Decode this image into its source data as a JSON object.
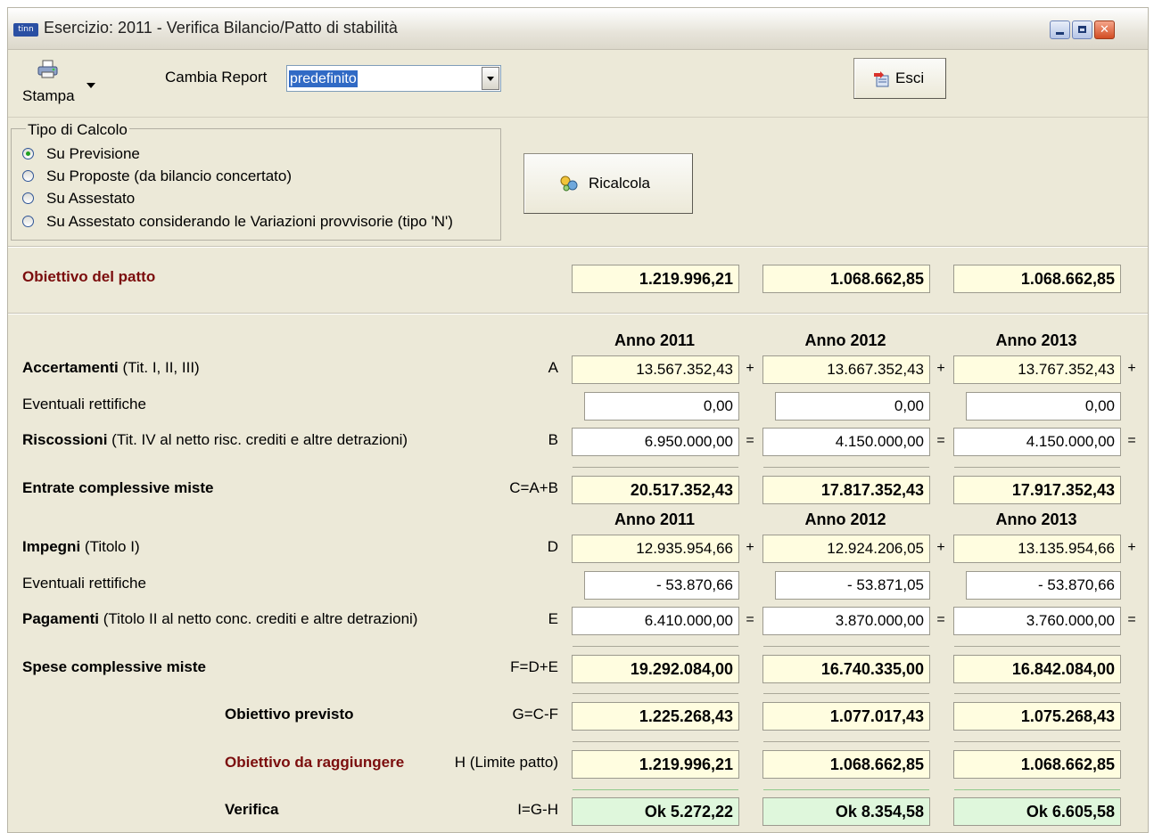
{
  "window": {
    "app_icon": "tinn",
    "title": "Esercizio: 2011 - Verifica Bilancio/Patto di stabilità",
    "controls": {
      "minimize": "minimize-icon",
      "maximize": "maximize-icon",
      "close": "close-icon"
    }
  },
  "toolbar": {
    "print_label": "Stampa",
    "print_icon": "printer-icon",
    "cambia_label": "Cambia Report",
    "report_value": "predefinito",
    "esci_label": "Esci",
    "esci_icon": "exit-icon"
  },
  "calcolo": {
    "title": "Tipo di Calcolo",
    "options": [
      {
        "label": "Su Previsione",
        "selected": true
      },
      {
        "label": "Su Proposte (da bilancio concertato)",
        "selected": false
      },
      {
        "label": "Su Assestato",
        "selected": false
      },
      {
        "label": "Su Assestato considerando le Variazioni provvisorie (tipo 'N')",
        "selected": false
      }
    ],
    "ricalcola_label": "Ricalcola",
    "ricalcola_icon": "recalc-icon"
  },
  "obiettivo_patto": {
    "label": "Obiettivo del patto",
    "values": [
      "1.219.996,21",
      "1.068.662,85",
      "1.068.662,85"
    ]
  },
  "years": [
    "Anno 2011",
    "Anno 2012",
    "Anno 2013"
  ],
  "entrate": {
    "accertamenti": {
      "label": "Accertamenti",
      "detail": "(Tit. I, II, III)",
      "formula": "A",
      "values": [
        "13.567.352,43",
        "13.667.352,43",
        "13.767.352,43"
      ],
      "op": "+"
    },
    "rettifiche": {
      "label": "Eventuali rettifiche",
      "values": [
        "0,00",
        "0,00",
        "0,00"
      ]
    },
    "riscossioni": {
      "label": "Riscossioni",
      "detail": "(Tit. IV al netto risc. crediti e altre detrazioni)",
      "formula": "B",
      "values": [
        "6.950.000,00",
        "4.150.000,00",
        "4.150.000,00"
      ],
      "op": "="
    },
    "totale": {
      "label": "Entrate complessive miste",
      "formula": "C=A+B",
      "values": [
        "20.517.352,43",
        "17.817.352,43",
        "17.917.352,43"
      ]
    }
  },
  "spese": {
    "impegni": {
      "label": "Impegni",
      "detail": "(Titolo I)",
      "formula": "D",
      "values": [
        "12.935.954,66",
        "12.924.206,05",
        "13.135.954,66"
      ],
      "op": "+"
    },
    "rettifiche": {
      "label": "Eventuali rettifiche",
      "values": [
        "- 53.870,66",
        "- 53.871,05",
        "- 53.870,66"
      ]
    },
    "pagamenti": {
      "label": "Pagamenti",
      "detail": "(Titolo II al netto conc. crediti e altre detrazioni)",
      "formula": "E",
      "values": [
        "6.410.000,00",
        "3.870.000,00",
        "3.760.000,00"
      ],
      "op": "="
    },
    "totale": {
      "label": "Spese complessive miste",
      "formula": "F=D+E",
      "values": [
        "19.292.084,00",
        "16.740.335,00",
        "16.842.084,00"
      ]
    }
  },
  "obiettivo_previsto": {
    "label": "Obiettivo previsto",
    "formula": "G=C-F",
    "values": [
      "1.225.268,43",
      "1.077.017,43",
      "1.075.268,43"
    ]
  },
  "obiettivo_raggiungere": {
    "label": "Obiettivo da raggiungere",
    "formula": "H (Limite patto)",
    "values": [
      "1.219.996,21",
      "1.068.662,85",
      "1.068.662,85"
    ]
  },
  "verifica": {
    "label": "Verifica",
    "formula": "I=G-H",
    "values": [
      "Ok 5.272,22",
      "Ok 8.354,58",
      "Ok 6.605,58"
    ]
  },
  "colors": {
    "window_bg": "#ece9d8",
    "dark_red": "#7b0d0d",
    "yellow_cell": "#fffde0",
    "green_cell": "#dff7dc",
    "selection": "#316ac5"
  }
}
